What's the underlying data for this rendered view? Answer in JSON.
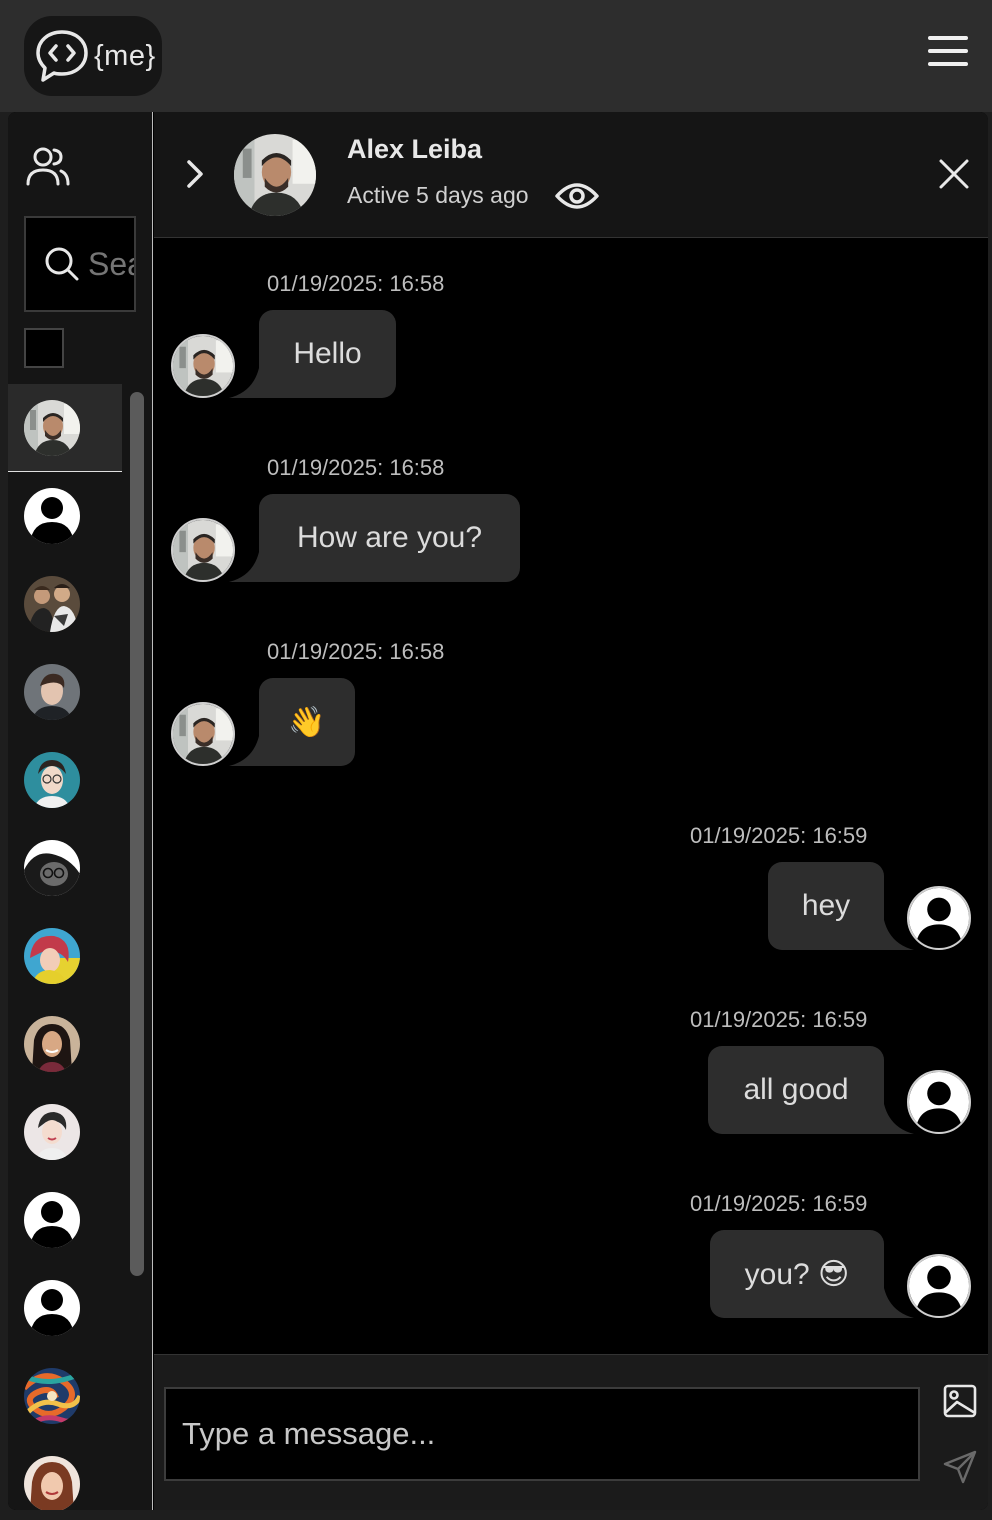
{
  "app": {
    "logo_text": "{me}"
  },
  "sidebar": {
    "search_placeholder": "Search",
    "contacts": [
      {
        "label": "contact-1",
        "avatar": "photo-man-dark-hair",
        "active": true
      },
      {
        "label": "contact-2",
        "avatar": "default-user-icon"
      },
      {
        "label": "contact-3",
        "avatar": "photo-two-men"
      },
      {
        "label": "contact-4",
        "avatar": "photo-young-man"
      },
      {
        "label": "contact-5",
        "avatar": "photo-woman-glasses"
      },
      {
        "label": "contact-6",
        "avatar": "photo-woman-glasses-bw"
      },
      {
        "label": "contact-7",
        "avatar": "photo-woman-red-hair"
      },
      {
        "label": "contact-8",
        "avatar": "photo-woman-dark-hair"
      },
      {
        "label": "contact-9",
        "avatar": "photo-woman-light"
      },
      {
        "label": "contact-10",
        "avatar": "default-user-icon"
      },
      {
        "label": "contact-11",
        "avatar": "default-user-icon"
      },
      {
        "label": "contact-12",
        "avatar": "abstract-swirl"
      },
      {
        "label": "contact-13",
        "avatar": "photo-woman-brown-hair"
      }
    ]
  },
  "chat": {
    "contact_name": "Alex Leiba",
    "contact_status": "Active 5 days ago",
    "messages": [
      {
        "direction": "in",
        "timestamp": "01/19/2025: 16:58",
        "text": "Hello"
      },
      {
        "direction": "in",
        "timestamp": "01/19/2025: 16:58",
        "text": "How are you?"
      },
      {
        "direction": "in",
        "timestamp": "01/19/2025: 16:58",
        "text": "👋"
      },
      {
        "direction": "out",
        "timestamp": "01/19/2025: 16:59",
        "text": "hey"
      },
      {
        "direction": "out",
        "timestamp": "01/19/2025: 16:59",
        "text": "all good"
      },
      {
        "direction": "out",
        "timestamp": "01/19/2025: 16:59",
        "text": "you? 😎"
      }
    ]
  },
  "composer": {
    "placeholder": "Type a message..."
  },
  "colors": {
    "background": "#000000",
    "topbar": "#2d2d2d",
    "bubble": "#2d2d2d",
    "sidebar": "#151515"
  }
}
